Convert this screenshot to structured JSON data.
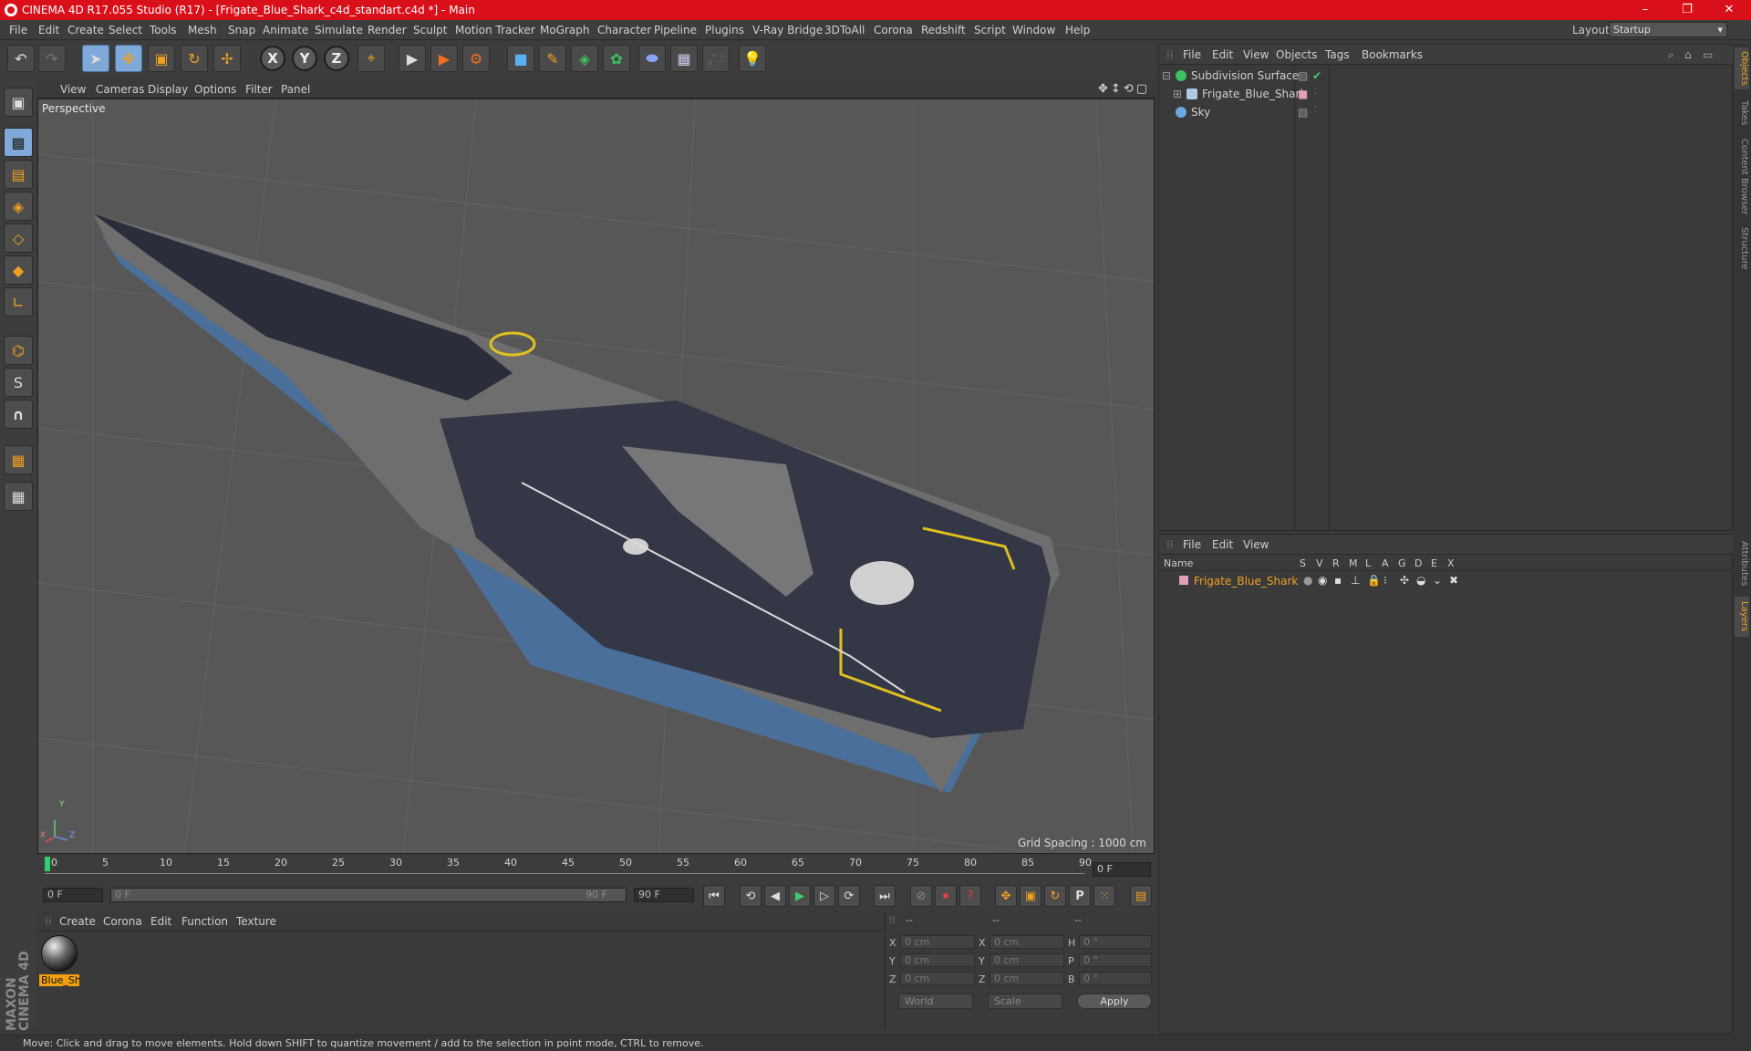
{
  "window": {
    "title": "CINEMA 4D R17.055 Studio (R17) - [Frigate_Blue_Shark_c4d_standart.c4d *] - Main",
    "minimize": "–",
    "restore": "❐",
    "close": "✕"
  },
  "menu": [
    "File",
    "Edit",
    "Create",
    "Select",
    "Tools",
    "Mesh",
    "Snap",
    "Animate",
    "Simulate",
    "Render",
    "Sculpt",
    "Motion Tracker",
    "MoGraph",
    "Character",
    "Pipeline",
    "Plugins",
    "V-Ray Bridge",
    "3DToAll",
    "Corona",
    "Redshift",
    "Script",
    "Window",
    "Help"
  ],
  "layout": {
    "label": "Layout:",
    "value": "Startup"
  },
  "toolbar": {
    "undo": "↶",
    "redo": "↷",
    "select": "➤",
    "move": "✥",
    "scale": "▣",
    "rotate": "↻",
    "transform": "✢",
    "x": "X",
    "y": "Y",
    "z": "Z",
    "coord": "⌖",
    "render_view": "▶",
    "render": "▶",
    "render_settings": "⚙",
    "cube": "■",
    "pen": "✎",
    "subdivide": "◈",
    "cloner": "✿",
    "deformer": "⬬",
    "floor": "▦",
    "camera": "🎥",
    "light": "💡"
  },
  "lefttools": [
    "▣",
    "▩",
    "▤",
    "◈",
    "◇",
    "◆",
    "∟",
    "⌬",
    "S",
    "∩",
    "▦",
    "▦"
  ],
  "viewport": {
    "menu": [
      "View",
      "Cameras",
      "Display",
      "Options",
      "Filter",
      "Panel"
    ],
    "nav": "✥↕⟲▢",
    "label": "Perspective",
    "grid_spacing": "Grid Spacing : 1000 cm",
    "axis_x": "X",
    "axis_y": "Y",
    "axis_z": "Z"
  },
  "timeline": {
    "ticks": [
      "0",
      "5",
      "10",
      "15",
      "20",
      "25",
      "30",
      "35",
      "40",
      "45",
      "50",
      "55",
      "60",
      "65",
      "70",
      "75",
      "80",
      "85",
      "90"
    ],
    "current": "0 F"
  },
  "playback": {
    "start": "0 F",
    "slider_start": "0 F",
    "slider_end": "90 F",
    "end": "90 F"
  },
  "material": {
    "menu": [
      "Create",
      "Corona",
      "Edit",
      "Function",
      "Texture"
    ],
    "name": "Blue_Sh"
  },
  "coordinates": {
    "header": [
      "--",
      "--",
      "--"
    ],
    "rows": [
      {
        "a": "X",
        "av": "0 cm",
        "b": "X",
        "bv": "0 cm",
        "c": "H",
        "cv": "0 °"
      },
      {
        "a": "Y",
        "av": "0 cm",
        "b": "Y",
        "bv": "0 cm",
        "c": "P",
        "cv": "0 °"
      },
      {
        "a": "Z",
        "av": "0 cm",
        "b": "Z",
        "bv": "0 cm",
        "c": "B",
        "cv": "0 °"
      }
    ],
    "mode": "World",
    "scale": "Scale",
    "apply": "Apply"
  },
  "objects": {
    "menu": [
      "File",
      "Edit",
      "View",
      "Objects",
      "Tags",
      "Bookmarks"
    ],
    "items": [
      {
        "name": "Subdivision Surface",
        "color": "#3cc060"
      },
      {
        "name": "Frigate_Blue_Shark",
        "color": "#b0c8e0"
      },
      {
        "name": "Sky",
        "color": "#6aa8e0"
      }
    ]
  },
  "layers": {
    "menu": [
      "File",
      "Edit",
      "View"
    ],
    "cols": [
      "Name",
      "S",
      "V",
      "R",
      "M",
      "L",
      "A",
      "G",
      "D",
      "E",
      "X"
    ],
    "row": "Frigate_Blue_Shark",
    "row_color": "#e0a0b8"
  },
  "sidetabs": [
    "Objects",
    "Takes",
    "Content Browser",
    "Structure",
    "Attributes",
    "Layers"
  ],
  "status": "Move: Click and drag to move elements. Hold down SHIFT to quantize movement / add to the selection in point mode, CTRL to remove.",
  "brand": "MAXON CINEMA 4D",
  "colors": {
    "accent": "#f0a020",
    "title": "#d9101a",
    "active_tool": "#7fa9d8"
  }
}
